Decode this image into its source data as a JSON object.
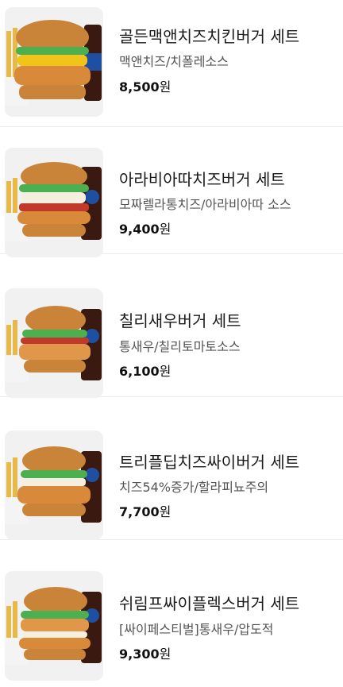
{
  "menu": {
    "items": [
      {
        "name": "골든맥앤치즈치킨버거 세트",
        "description": "맥앤치즈/치폴레소스",
        "price": "8,500",
        "currency": "원",
        "image_icon": "burger-set-image"
      },
      {
        "name": "아라비아따치즈버거 세트",
        "description": "모짜렐라통치즈/아라비아따 소스",
        "price": "9,400",
        "currency": "원",
        "image_icon": "burger-set-image"
      },
      {
        "name": "칠리새우버거 세트",
        "description": "통새우/칠리토마토소스",
        "price": "6,100",
        "currency": "원",
        "image_icon": "burger-set-image"
      },
      {
        "name": "트리플딥치즈싸이버거 세트",
        "description": "치즈54%증가/할라피뇨주의",
        "price": "7,700",
        "currency": "원",
        "image_icon": "burger-set-image"
      },
      {
        "name": "쉬림프싸이플렉스버거 세트",
        "description": "[싸이페스티벌]통새우/압도적",
        "price": "9,300",
        "currency": "원",
        "image_icon": "burger-set-image"
      }
    ]
  },
  "colors": {
    "thumb_bg": "#f1f1f1",
    "divider": "#ececec",
    "bun": "#c9843a",
    "lettuce": "#4caf50",
    "patty": "#d9893a",
    "cola": "#3a1a10",
    "fries": "#e7b84a"
  }
}
